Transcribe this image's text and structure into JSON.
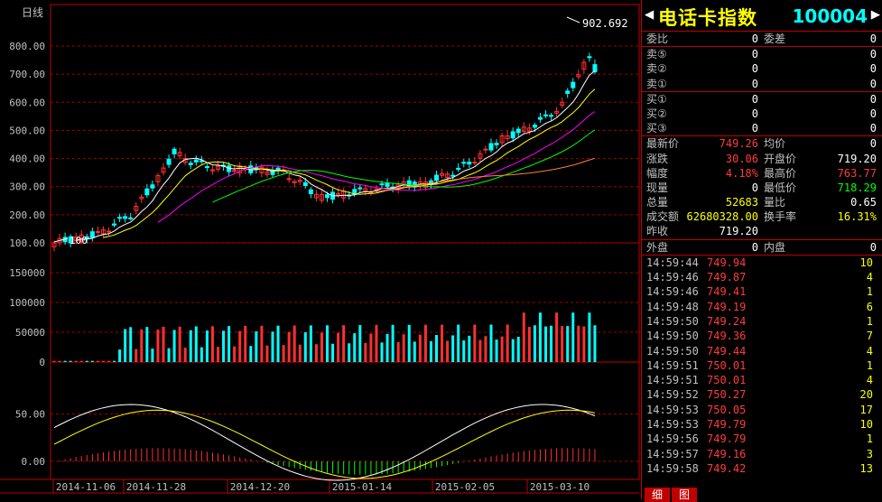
{
  "chart": {
    "period_label": "日线",
    "price_axis": [
      "800.00",
      "700.00",
      "600.00",
      "500.00",
      "400.00",
      "300.00",
      "200.00",
      "100.00"
    ],
    "vol_axis": [
      "150000",
      "100000",
      "50000",
      "0"
    ],
    "macd_axis": [
      "50.00",
      "0.00"
    ],
    "date_labels": [
      "2014-11-06",
      "2014-11-28",
      "2014-12-20",
      "2015-01-14",
      "2015-02-05",
      "2015-03-10"
    ],
    "high_marker": "902.692",
    "low_marker": "100",
    "colors": {
      "up": "#ff3030",
      "down": "#00ffff",
      "grid": "#c00000",
      "ma5": "#ffffff",
      "ma10": "#ffff00",
      "ma20": "#ff00ff",
      "ma30": "#00ff00",
      "ma60": "#ff8040"
    }
  },
  "panel": {
    "title": "电话卡指数",
    "code": "100004",
    "order_book": [
      {
        "l": "委比",
        "v1": "0",
        "l2": "委差",
        "v2": "0"
      },
      {
        "l": "卖⑤",
        "v1": "0",
        "l2": "",
        "v2": "0"
      },
      {
        "l": "卖②",
        "v1": "0",
        "l2": "",
        "v2": "0"
      },
      {
        "l": "卖①",
        "v1": "0",
        "l2": "",
        "v2": "0"
      },
      {
        "l": "买①",
        "v1": "0",
        "l2": "",
        "v2": "0"
      },
      {
        "l": "买②",
        "v1": "0",
        "l2": "",
        "v2": "0"
      },
      {
        "l": "买③",
        "v1": "0",
        "l2": "",
        "v2": "0"
      }
    ],
    "quote": [
      {
        "l": "最新价",
        "v1": "749.26",
        "c1": "red",
        "l2": "均价",
        "v2": "0",
        "c2": "white"
      },
      {
        "l": "涨跌",
        "v1": "30.06",
        "c1": "red",
        "l2": "开盘价",
        "v2": "719.20",
        "c2": "white"
      },
      {
        "l": "幅度",
        "v1": "4.18%",
        "c1": "red",
        "l2": "最高价",
        "v2": "763.77",
        "c2": "red"
      },
      {
        "l": "现量",
        "v1": "0",
        "c1": "white",
        "l2": "最低价",
        "v2": "718.29",
        "c2": "green"
      },
      {
        "l": "总量",
        "v1": "52683",
        "c1": "yellow",
        "l2": "量比",
        "v2": "0.65",
        "c2": "white"
      },
      {
        "l": "成交额",
        "v1": "62680328.00",
        "c1": "yellow",
        "l2": "换手率",
        "v2": "16.31%",
        "c2": "yellow"
      },
      {
        "l": "昨收",
        "v1": "719.20",
        "c1": "white",
        "l2": "",
        "v2": "",
        "c2": "white"
      }
    ],
    "outer_inner": {
      "l": "外盘",
      "v1": "0",
      "l2": "内盘",
      "v2": "0"
    },
    "ticks": [
      {
        "t": "14:59:44",
        "p": "749.94",
        "q": "10"
      },
      {
        "t": "14:59:46",
        "p": "749.87",
        "q": "4"
      },
      {
        "t": "14:59:46",
        "p": "749.41",
        "q": "1"
      },
      {
        "t": "14:59:48",
        "p": "749.19",
        "q": "6"
      },
      {
        "t": "14:59:50",
        "p": "749.24",
        "q": "1"
      },
      {
        "t": "14:59:50",
        "p": "749.36",
        "q": "7"
      },
      {
        "t": "14:59:50",
        "p": "749.44",
        "q": "4"
      },
      {
        "t": "14:59:51",
        "p": "750.01",
        "q": "1"
      },
      {
        "t": "14:59:51",
        "p": "750.01",
        "q": "4"
      },
      {
        "t": "14:59:52",
        "p": "750.27",
        "q": "20"
      },
      {
        "t": "14:59:53",
        "p": "750.05",
        "q": "17"
      },
      {
        "t": "14:59:53",
        "p": "749.79",
        "q": "10"
      },
      {
        "t": "14:59:56",
        "p": "749.79",
        "q": "1"
      },
      {
        "t": "14:59:57",
        "p": "749.16",
        "q": "3"
      },
      {
        "t": "14:59:58",
        "p": "749.42",
        "q": "13"
      }
    ],
    "tabs": [
      "细",
      "图"
    ]
  }
}
